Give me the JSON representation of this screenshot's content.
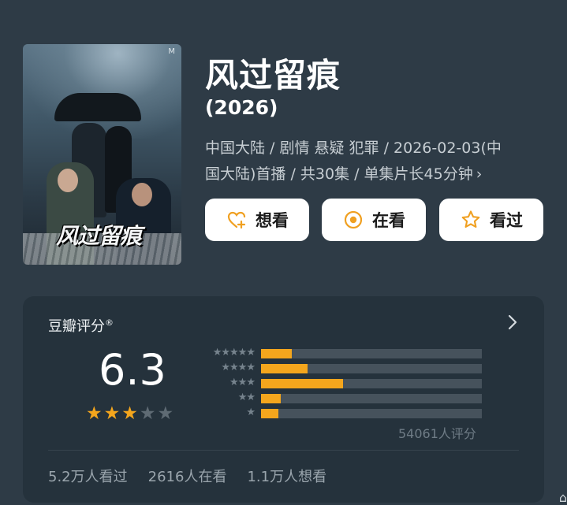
{
  "show": {
    "title": "风过留痕",
    "year": "(2026)",
    "meta_line1": "中国大陆 / 剧情 悬疑 犯罪 / 2026-02-03(中",
    "meta_line2": "国大陆)首播 / 共30集 / 单集片长45分钟",
    "meta_chevron": "›",
    "poster_title": "风过留痕",
    "poster_mark": "M"
  },
  "actions": [
    {
      "label": "想看",
      "icon": "heart-plus-icon"
    },
    {
      "label": "在看",
      "icon": "target-circle-icon"
    },
    {
      "label": "看过",
      "icon": "star-outline-icon"
    }
  ],
  "rating": {
    "title": "豆瓣评分",
    "title_mark": "®",
    "score": "6.3",
    "stars_filled": 3,
    "stars_total": 5,
    "distribution": [
      {
        "stars": 5,
        "label": "★★★★★",
        "fraction": 0.14
      },
      {
        "stars": 4,
        "label": "★★★★",
        "fraction": 0.21
      },
      {
        "stars": 3,
        "label": "★★★",
        "fraction": 0.37
      },
      {
        "stars": 2,
        "label": "★★",
        "fraction": 0.09
      },
      {
        "stars": 1,
        "label": "★",
        "fraction": 0.08
      }
    ],
    "count_text": "54061人评分",
    "watched": "5.2万人看过",
    "watching": "2616人在看",
    "want": "1.1万人想看"
  },
  "colors": {
    "background": "#2e3b46",
    "card": "#25323c",
    "accent": "#f4a61d",
    "star_empty": "#5f6b74",
    "icon_accent": "#f0a021"
  },
  "watermark": "⌂"
}
